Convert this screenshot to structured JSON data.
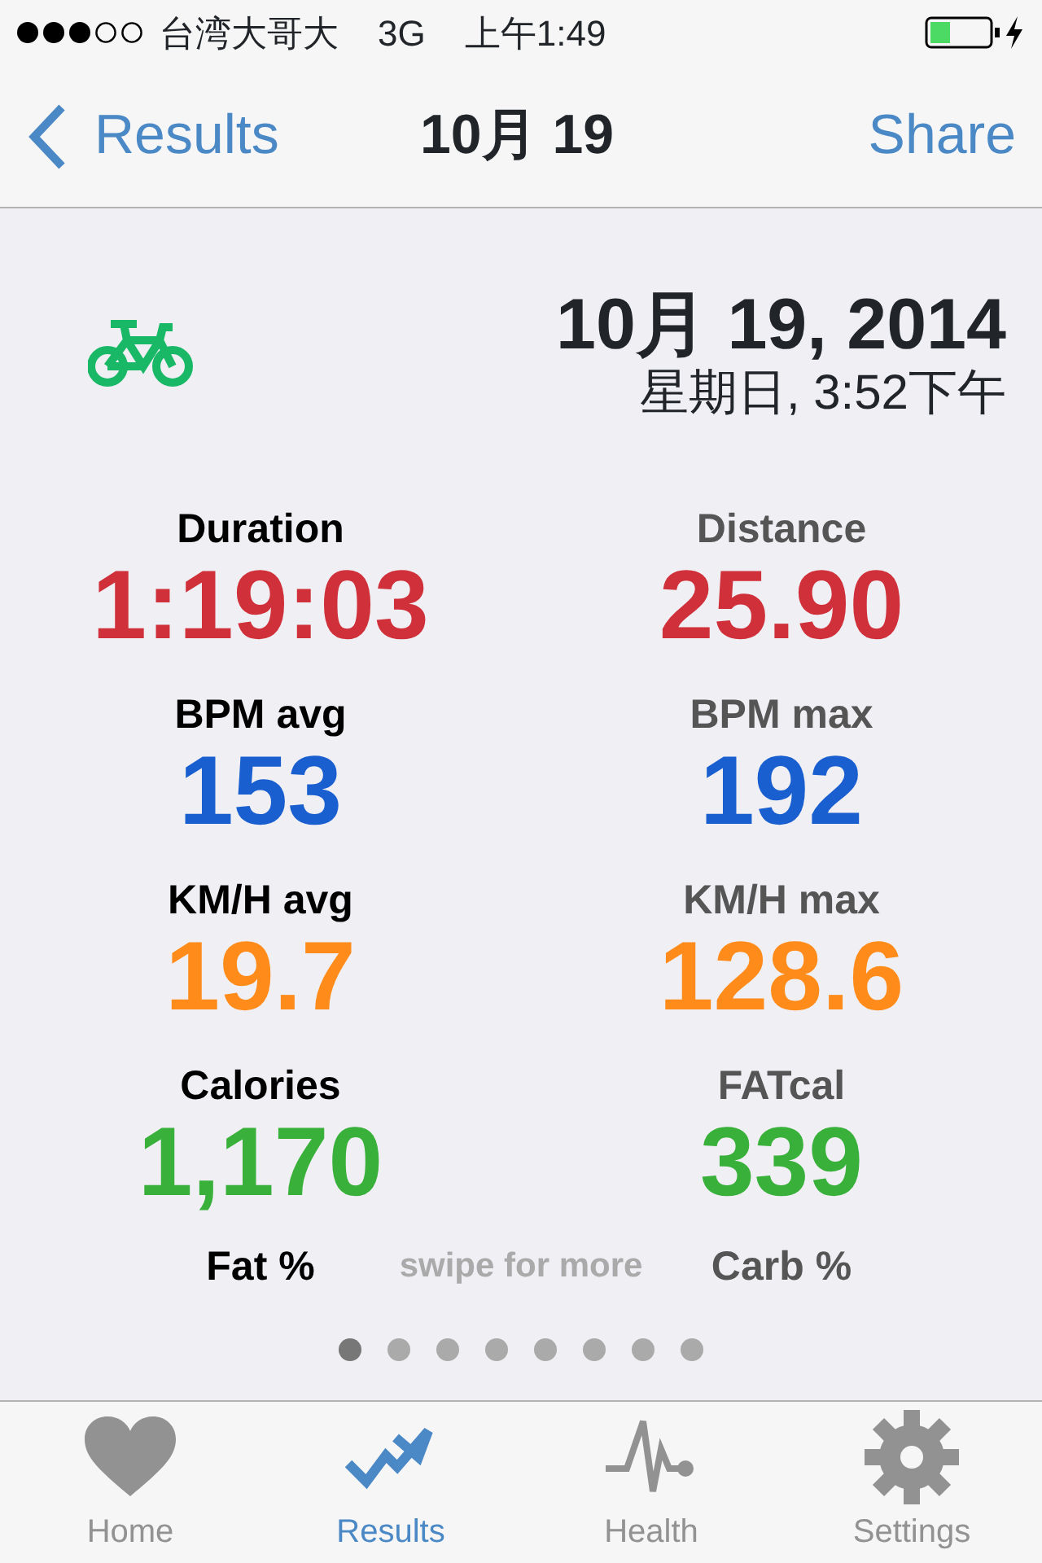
{
  "status_bar": {
    "signal_dots": [
      {
        "filled": true
      },
      {
        "filled": true
      },
      {
        "filled": true
      },
      {
        "filled": false
      },
      {
        "filled": false
      }
    ],
    "carrier": "台湾大哥大",
    "network": "3G",
    "time": "上午1:49",
    "charging": true
  },
  "nav_bar": {
    "back": "Results",
    "title": "10月 19",
    "action": "Share"
  },
  "workout": {
    "date": "10月 19, 2014",
    "subtitle": "星期日, 3:52下午"
  },
  "metrics": [
    {
      "label": "Duration",
      "value": "1:19:03",
      "color": "#d0303a",
      "kind": "dark"
    },
    {
      "label": "Distance",
      "value": "25.90",
      "color": "#d0303a",
      "kind": "grey"
    },
    {
      "label": "BPM avg",
      "value": "153",
      "color": "#1a5fcf",
      "kind": "dark"
    },
    {
      "label": "BPM max",
      "value": "192",
      "color": "#1a5fcf",
      "kind": "grey"
    },
    {
      "label": "KM/H avg",
      "value": "19.7",
      "color": "#ff8c1a",
      "kind": "dark"
    },
    {
      "label": "KM/H max",
      "value": "128.6",
      "color": "#ff8c1a",
      "kind": "grey"
    },
    {
      "label": "Calories",
      "value": "1,170",
      "color": "#38b03a",
      "kind": "dark"
    },
    {
      "label": "FATcal",
      "value": "339",
      "color": "#38b03a",
      "kind": "grey"
    }
  ],
  "more_row": {
    "left_label": "Fat %",
    "hint": "swipe for more",
    "right_label": "Carb %"
  },
  "page_dots": [
    {
      "selected": true
    },
    {
      "selected": false
    },
    {
      "selected": false
    },
    {
      "selected": false
    },
    {
      "selected": false
    },
    {
      "selected": false
    },
    {
      "selected": false
    },
    {
      "selected": false
    }
  ],
  "tabs": [
    {
      "label": "Home",
      "kind": "heart",
      "selected": false
    },
    {
      "label": "Results",
      "kind": "trend",
      "selected": true
    },
    {
      "label": "Health",
      "kind": "pulse",
      "selected": false
    },
    {
      "label": "Settings",
      "kind": "gear",
      "selected": false
    }
  ]
}
